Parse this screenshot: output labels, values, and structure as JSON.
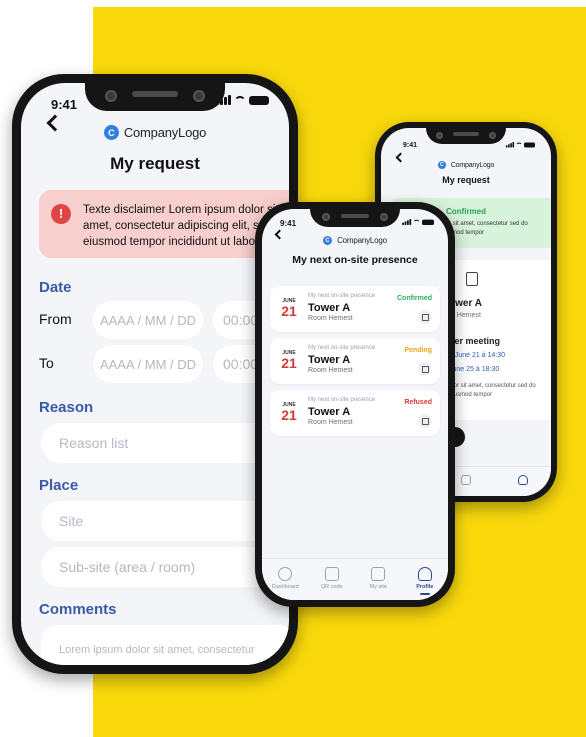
{
  "phone1": {
    "time": "9:41",
    "logo_mark": "C",
    "logo_text": "CompanyLogo",
    "title": "My request",
    "disclaimer": "Texte disclaimer Lorem ipsum dolor sit amet, consectetur adipiscing elit, sed do eiusmod tempor incididunt ut labore et",
    "date_label": "Date",
    "from_label": "From",
    "to_label": "To",
    "date_placeholder": "AAAA / MM / DD",
    "time_placeholder": "00:00",
    "reason_label": "Reason",
    "reason_placeholder": "Reason list",
    "place_label": "Place",
    "site_placeholder": "Site",
    "subsite_placeholder": "Sub-site (area / room)",
    "comments_label": "Comments",
    "comments_placeholder": "Lorem ipsum dolor sit amet, consectetur"
  },
  "phone2": {
    "time": "9:41",
    "logo_mark": "C",
    "logo_text": "CompanyLogo",
    "title": "My next on-site presence",
    "cards": [
      {
        "kicker": "My next on-site presence",
        "month": "JUNE",
        "day": "21",
        "tower": "Tower A",
        "room": "Room Hemest",
        "status": "Confirmed",
        "status_color": "#2fae5b"
      },
      {
        "kicker": "My next on-site presence",
        "month": "JUNE",
        "day": "21",
        "tower": "Tower A",
        "room": "Room Hemest",
        "status": "Pending",
        "status_color": "#f0a21a"
      },
      {
        "kicker": "My next on-site presence",
        "month": "JUNE",
        "day": "21",
        "tower": "Tower A",
        "room": "Room Hemest",
        "status": "Refused",
        "status_color": "#d83a3a"
      }
    ],
    "tabs": [
      {
        "label": "Dashboard",
        "icon": "dashboard-icon"
      },
      {
        "label": "QR code",
        "icon": "qr-code-icon"
      },
      {
        "label": "My site",
        "icon": "building-icon"
      },
      {
        "label": "Profile",
        "icon": "profile-icon"
      }
    ]
  },
  "phone3": {
    "time": "9:41",
    "logo_mark": "C",
    "logo_text": "CompanyLogo",
    "title": "My request",
    "green_title": "Confirmed",
    "green_text": "olor sit amet, consectetur sed do eiusmod tempor",
    "tower": "ower A",
    "room": "m Hemest",
    "meeting_title": "ner meeting",
    "meeting_1": "0 June 21 à 14:30",
    "meeting_2": "June 25 à 18:30",
    "meeting_text": "olor sit amet, consectetur sed do eiusmod tempor"
  },
  "colors": {
    "background_accent": "#f9d90c",
    "section_label": "#3a5aa6",
    "disclaimer_bg": "#f7cfcd"
  }
}
